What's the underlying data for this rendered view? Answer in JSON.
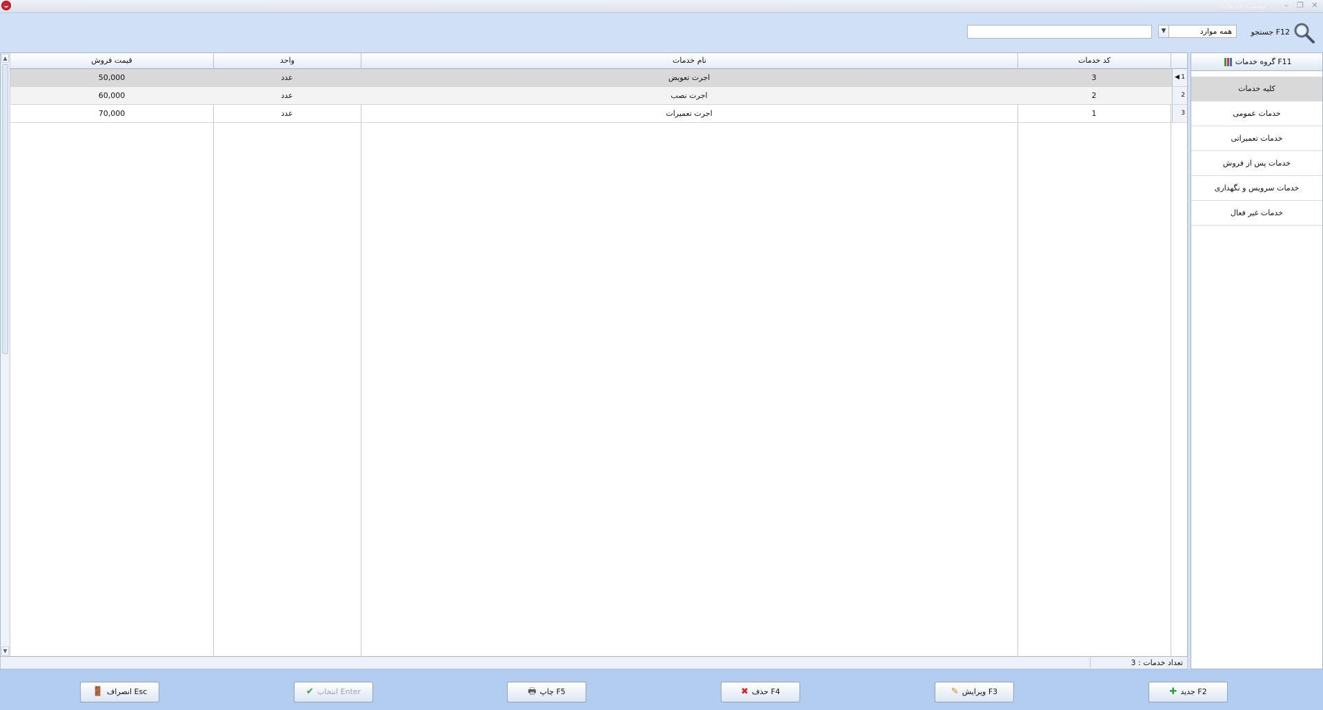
{
  "window": {
    "title": "لیست خدمات"
  },
  "toolbar": {
    "search_label": "جستجو F12",
    "filter_value": "همه موارد",
    "search_value": ""
  },
  "grid": {
    "columns": [
      "کد خدمات",
      "نام خدمات",
      "واحد",
      "قیمت فروش"
    ],
    "rows": [
      {
        "num": "1",
        "code": "3",
        "name": "اجرت تعویض",
        "unit": "عدد",
        "price": "50,000"
      },
      {
        "num": "2",
        "code": "2",
        "name": "اجرت نصب",
        "unit": "عدد",
        "price": "60,000"
      },
      {
        "num": "3",
        "code": "1",
        "name": "اجرت تعمیرات",
        "unit": "عدد",
        "price": "70,000"
      }
    ]
  },
  "status": {
    "count_text": "تعداد خدمات : 3"
  },
  "sidebar": {
    "header": "گروه خدمات F11",
    "items": [
      "کلیه خدمات",
      "خدمات عمومی",
      "خدمات تعمیراتی",
      "خدمات پس از فروش",
      "خدمات سرویس و نگهداری",
      "خدمات غیر فعال"
    ],
    "active_index": 0
  },
  "buttons": {
    "new": "جدید F2",
    "edit": "ویرایش F3",
    "delete": "حذف F4",
    "print": "چاپ F5",
    "select": "انتخاب Enter",
    "cancel": "انصراف Esc"
  }
}
